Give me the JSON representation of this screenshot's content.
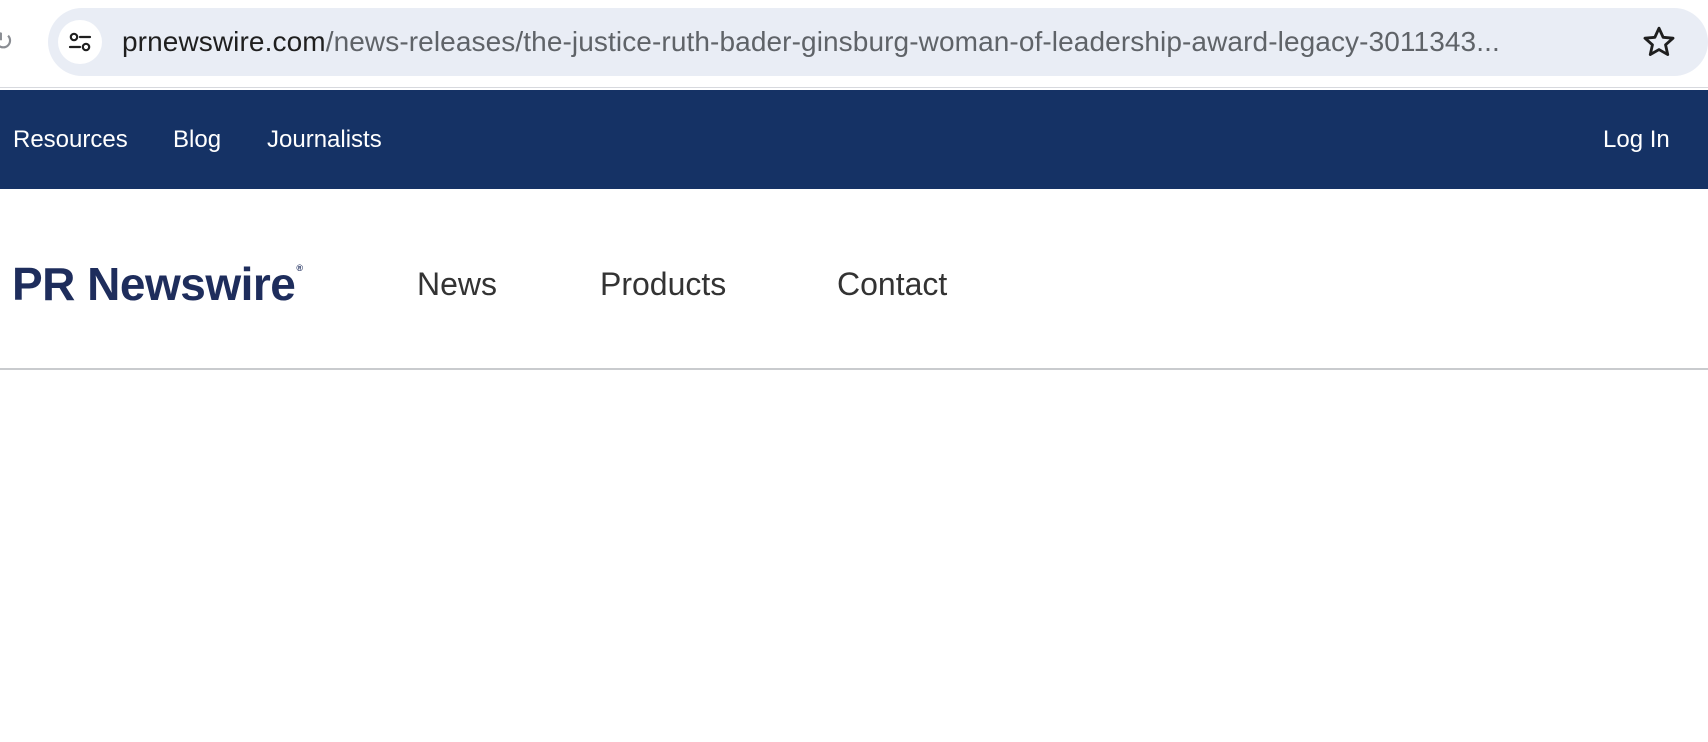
{
  "browser": {
    "url_host": "prnewswire.com",
    "url_path": "/news-releases/the-justice-ruth-bader-ginsburg-woman-of-leadership-award-legacy-3011343...",
    "site_info_icon": "tune-icon",
    "bookmark_icon": "star-outline-icon",
    "reload_icon": "reload-icon"
  },
  "topnav": {
    "items": [
      {
        "label": "Resources"
      },
      {
        "label": "Blog"
      },
      {
        "label": "Journalists"
      }
    ],
    "login_label": "Log In",
    "background": "#153265"
  },
  "mainnav": {
    "logo_text": "PR Newswire",
    "logo_mark": "®",
    "items": [
      {
        "label": "News"
      },
      {
        "label": "Products"
      },
      {
        "label": "Contact"
      }
    ],
    "logo_color": "#1e2d5c"
  }
}
